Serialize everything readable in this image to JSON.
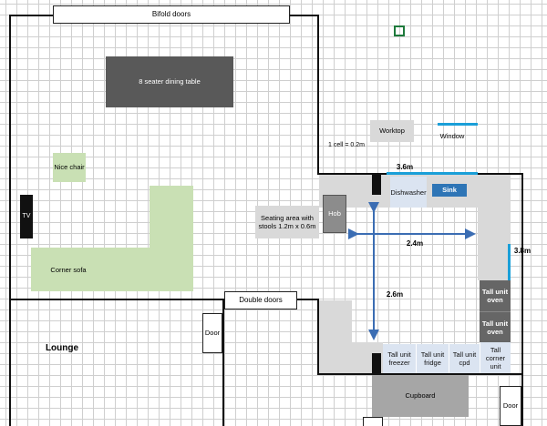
{
  "labels": {
    "bifold_doors": "Bifold doors",
    "dining_table": "8 seater dining table",
    "nice_chair": "Nice chair",
    "tv": "TV",
    "corner_sofa": "Corner sofa",
    "worktop_key": "Worktop",
    "window_key": "Window",
    "scale": "1 cell = 0.2m",
    "width_top": "3.6m",
    "dishwasher": "Dishwasher",
    "sink": "Sink",
    "hob": "Hob",
    "seating_area": "Seating area with stools 1.2m x 0.6m",
    "width_inner": "2.4m",
    "depth_right": "3.8m",
    "double_doors": "Double doors",
    "depth_inner": "2.6m",
    "oven_1": "Tall unit oven",
    "oven_2": "Tall unit oven",
    "door_left": "Door",
    "lounge": "Lounge",
    "freezer": "Tall unit freezer",
    "fridge": "Tall unit fridge",
    "tall_cpd": "Tall unit cpd",
    "corner_unit": "Tall corner unit",
    "cupboard": "Cupboard",
    "door_right": "Door"
  },
  "colors": {
    "wall": "#111111",
    "sofa": "#c9e0b4",
    "worktop": "#d9d9d9",
    "window": "#1a9fd8",
    "arrow": "#3b6db3",
    "dining_table": "#595959",
    "appliance_blue": "#dbe4f1",
    "appliance_grey": "#666666",
    "sink": "#2e75b6",
    "cupboard": "#a6a6a6"
  }
}
